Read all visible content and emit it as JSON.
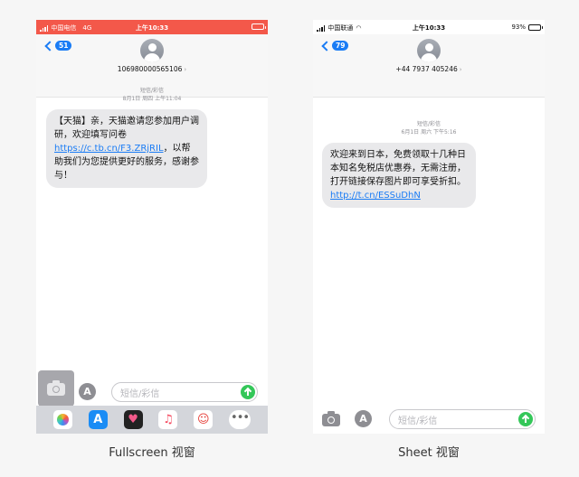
{
  "left_phone": {
    "status": {
      "carrier": "中国电信",
      "network": "4G",
      "time": "上午10:33"
    },
    "nav": {
      "back_badge": "51",
      "contact": "106980000565106"
    },
    "message": {
      "type_label": "短信/彩信",
      "date": "8月1日 周四 上午11:04",
      "text_before": "【天猫】亲，天猫邀请您参加用户调研，欢迎填写问卷",
      "link": "https://c.tb.cn/F3.ZRjRIL",
      "text_after": "，以帮助我们为您提供更好的服务，感谢参与！"
    },
    "input": {
      "placeholder": "短信/彩信"
    },
    "tray_icons": [
      "photos-icon",
      "app-store-icon",
      "digital-touch-icon",
      "music-icon",
      "sticker-icon",
      "more-icon"
    ]
  },
  "right_phone": {
    "status": {
      "carrier": "中国联通",
      "time": "上午10:33",
      "battery": "93%",
      "battery_level": 0.93
    },
    "nav": {
      "back_badge": "79",
      "contact": "+44 7937 405246"
    },
    "message": {
      "type_label": "短信/彩信",
      "date": "6月1日 周六 下午5:16",
      "text_before": "欢迎来到日本，免费领取十几种日本知名免税店优惠券，无需注册，打开链接保存图片即可享受折扣。",
      "link": "http://t.cn/ESSuDhN"
    },
    "input": {
      "placeholder": "短信/彩信"
    }
  },
  "captions": {
    "left": "Fullscreen 视窗",
    "right": "Sheet 视窗"
  }
}
